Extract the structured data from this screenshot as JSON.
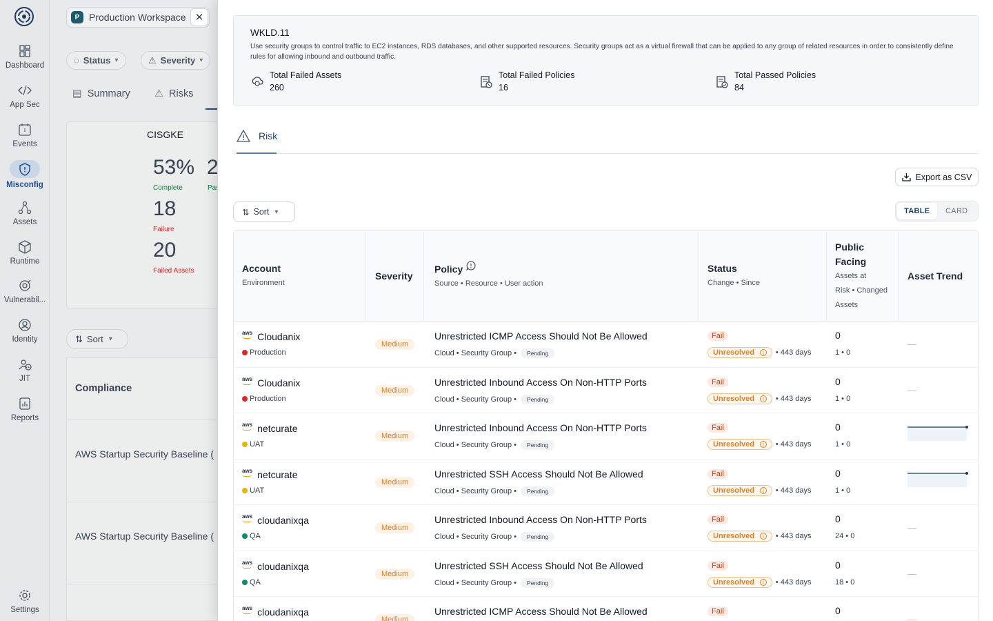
{
  "nav": {
    "items": [
      {
        "label": "Dashboard",
        "icon": "dashboard-icon",
        "active": false
      },
      {
        "label": "App Sec",
        "icon": "code-icon",
        "active": false
      },
      {
        "label": "Events",
        "icon": "events-icon",
        "active": false
      },
      {
        "label": "Misconfig",
        "icon": "shield-icon",
        "active": true
      },
      {
        "label": "Assets",
        "icon": "assets-icon",
        "active": false
      },
      {
        "label": "Runtime",
        "icon": "cube-icon",
        "active": false
      },
      {
        "label": "Vulnerabil...",
        "icon": "bug-icon",
        "active": false
      },
      {
        "label": "Identity",
        "icon": "user-icon",
        "active": false
      },
      {
        "label": "JIT",
        "icon": "jit-icon",
        "active": false
      },
      {
        "label": "Reports",
        "icon": "report-icon",
        "active": false
      }
    ],
    "settings_label": "Settings"
  },
  "background": {
    "workspace": {
      "initial": "P",
      "name": "Production Workspace"
    },
    "filters": {
      "status": "Status",
      "severity": "Severity"
    },
    "tabs": {
      "summary": "Summary",
      "risks": "Risks"
    },
    "card": {
      "name": "CISGKE",
      "percent": "53%",
      "percent_label": "Complete",
      "second_value": "2",
      "second_label": "Pas",
      "failure_value": "18",
      "failure_label": "Failure",
      "failed_assets_value": "20",
      "failed_assets_label": "Failed Assets"
    },
    "sort_label": "Sort",
    "table_header": "Compliance",
    "rows": [
      "AWS Startup Security Baseline (",
      "AWS Startup Security Baseline ("
    ]
  },
  "drawer": {
    "code": "WKLD.11",
    "description": "Use security groups to control traffic to EC2 instances, RDS databases, and other supported resources. Security groups act as a virtual firewall that can be applied to any group of related resources in order to consistently define rules for allowing inbound and outbound traffic.",
    "stats": [
      {
        "label": "Total Failed Assets",
        "value": "260"
      },
      {
        "label": "Total Failed Policies",
        "value": "16"
      },
      {
        "label": "Total Passed Policies",
        "value": "84"
      }
    ],
    "tab_label": "Risk",
    "export_label": "Export as CSV",
    "sort_label": "Sort",
    "view_toggle": {
      "table": "TABLE",
      "card": "CARD",
      "selected": "TABLE"
    },
    "columns": {
      "account": "Account",
      "account_sub": "Environment",
      "severity": "Severity",
      "policy": "Policy",
      "policy_sub": [
        "Source",
        "Resource",
        "User action"
      ],
      "status": "Status",
      "status_sub": [
        "Change",
        "Since"
      ],
      "public_line1": "Public",
      "public_line2": "Facing",
      "public_sub1": "Assets at",
      "public_sub2": "Risk",
      "public_sub3": "Changed",
      "public_sub4": "Assets",
      "trend": "Asset Trend"
    },
    "rows": [
      {
        "cloud": "aws",
        "account": "Cloudanix",
        "env": "Production",
        "env_color": "#dc2626",
        "severity": "Medium",
        "policy": "Unrestricted ICMP Access Should Not Be Allowed",
        "source": "Cloud",
        "resource": "Security Group",
        "action": "Pending",
        "status": "Fail",
        "change": "Unresolved",
        "since": "443 days",
        "public": "0",
        "risk": "1",
        "changed": "0",
        "trend": "none"
      },
      {
        "cloud": "aws",
        "account": "Cloudanix",
        "env": "Production",
        "env_color": "#dc2626",
        "severity": "Medium",
        "policy": "Unrestricted Inbound Access On Non-HTTP Ports",
        "source": "Cloud",
        "resource": "Security Group",
        "action": "Pending",
        "status": "Fail",
        "change": "Unresolved",
        "since": "443 days",
        "public": "0",
        "risk": "1",
        "changed": "0",
        "trend": "none"
      },
      {
        "cloud": "aws",
        "account": "netcurate",
        "env": "UAT",
        "env_color": "#eab308",
        "severity": "Medium",
        "policy": "Unrestricted Inbound Access On Non-HTTP Ports",
        "source": "Cloud",
        "resource": "Security Group",
        "action": "Pending",
        "status": "Fail",
        "change": "Unresolved",
        "since": "443 days",
        "public": "0",
        "risk": "1",
        "changed": "0",
        "trend": "flat"
      },
      {
        "cloud": "aws",
        "account": "netcurate",
        "env": "UAT",
        "env_color": "#eab308",
        "severity": "Medium",
        "policy": "Unrestricted SSH Access Should Not Be Allowed",
        "source": "Cloud",
        "resource": "Security Group",
        "action": "Pending",
        "status": "Fail",
        "change": "Unresolved",
        "since": "443 days",
        "public": "0",
        "risk": "1",
        "changed": "0",
        "trend": "flat"
      },
      {
        "cloud": "aws",
        "account": "cloudanixqa",
        "env": "QA",
        "env_color": "#0f8a6c",
        "severity": "Medium",
        "policy": "Unrestricted Inbound Access On Non-HTTP Ports",
        "source": "Cloud",
        "resource": "Security Group",
        "action": "Pending",
        "status": "Fail",
        "change": "Unresolved",
        "since": "443 days",
        "public": "0",
        "risk": "24",
        "changed": "0",
        "trend": "none"
      },
      {
        "cloud": "aws",
        "account": "cloudanixqa",
        "env": "QA",
        "env_color": "#0f8a6c",
        "severity": "Medium",
        "policy": "Unrestricted SSH Access Should Not Be Allowed",
        "source": "Cloud",
        "resource": "Security Group",
        "action": "Pending",
        "status": "Fail",
        "change": "Unresolved",
        "since": "443 days",
        "public": "0",
        "risk": "18",
        "changed": "0",
        "trend": "none"
      },
      {
        "cloud": "aws",
        "account": "cloudanixqa",
        "env": "",
        "env_color": "#0f8a6c",
        "severity": "Medium",
        "policy": "Unrestricted ICMP Access Should Not Be Allowed",
        "source": "",
        "resource": "",
        "action": "",
        "status": "Fail",
        "change": "",
        "since": "",
        "public": "0",
        "risk": "",
        "changed": "",
        "trend": "none"
      }
    ]
  }
}
